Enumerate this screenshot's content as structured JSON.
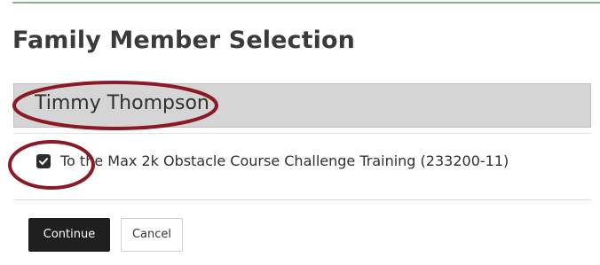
{
  "page": {
    "title": "Family Member Selection"
  },
  "member": {
    "name": "Timmy Thompson"
  },
  "course": {
    "label": "To the Max 2k Obstacle Course Challenge Training (233200-11)",
    "checked": true
  },
  "actions": {
    "continue_label": "Continue",
    "cancel_label": "Cancel"
  },
  "colors": {
    "annotation": "#8b1a24",
    "member_bar": "#d5d5d5",
    "primary_button": "#1f1f1f"
  },
  "icons": {
    "checkbox": "checkmark-icon"
  }
}
